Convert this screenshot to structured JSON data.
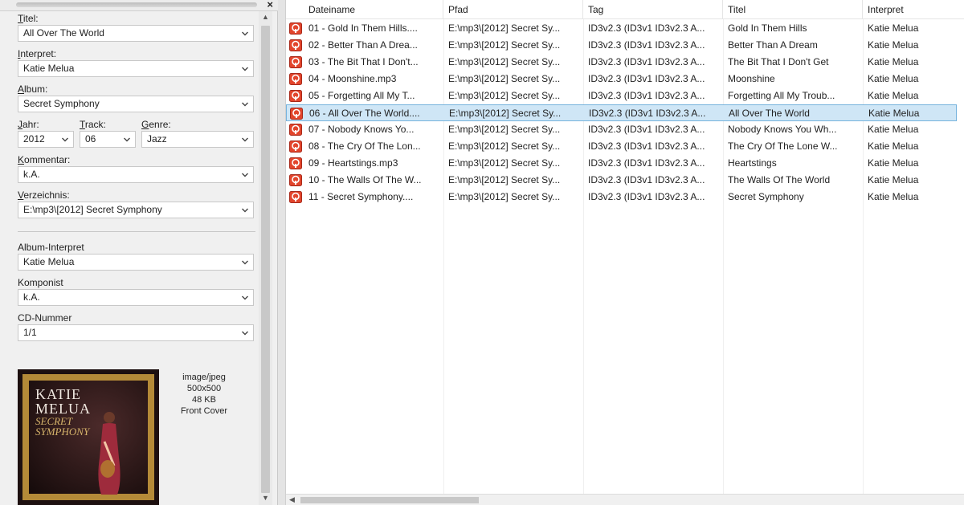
{
  "tag_panel": {
    "fields": {
      "titel": {
        "label_u": "T",
        "label_rest": "itel:",
        "value": "All Over The World"
      },
      "interpret": {
        "label_u": "I",
        "label_rest": "nterpret:",
        "value": "Katie Melua"
      },
      "album": {
        "label_u": "A",
        "label_rest": "lbum:",
        "value": "Secret Symphony"
      },
      "jahr": {
        "label_u": "J",
        "label_rest": "ahr:",
        "value": "2012"
      },
      "track": {
        "label_u": "T",
        "label_rest": "rack:",
        "value": "06"
      },
      "genre": {
        "label_u": "G",
        "label_rest": "enre:",
        "value": "Jazz"
      },
      "kommentar": {
        "label_u": "K",
        "label_rest": "ommentar:",
        "value": "k.A."
      },
      "verzeichnis": {
        "label_u": "V",
        "label_rest": "erzeichnis:",
        "value": "E:\\mp3\\[2012] Secret Symphony"
      },
      "album_interpret": {
        "label": "Album-Interpret",
        "value": "Katie Melua"
      },
      "komponist": {
        "label": "Komponist",
        "value": "k.A."
      },
      "cd_nummer": {
        "label": "CD-Nummer",
        "value": "1/1"
      }
    },
    "cover": {
      "art_title": "KATIE MELUA",
      "art_title_line1": "KATIE",
      "art_title_line2": "MELUA",
      "art_sub_line1": "SECRET",
      "art_sub_line2": "SYMPHONY",
      "mime": "image/jpeg",
      "dimensions": "500x500",
      "size": "48 KB",
      "type": "Front Cover"
    }
  },
  "file_list": {
    "columns": [
      "Dateiname",
      "Pfad",
      "Tag",
      "Titel",
      "Interpret"
    ],
    "rows": [
      {
        "dateiname": "01 - Gold In Them Hills....",
        "pfad": "E:\\mp3\\[2012] Secret Sy...",
        "tag": "ID3v2.3 (ID3v1 ID3v2.3 A...",
        "titel": "Gold In Them Hills",
        "interpret": "Katie Melua"
      },
      {
        "dateiname": "02 - Better Than A Drea...",
        "pfad": "E:\\mp3\\[2012] Secret Sy...",
        "tag": "ID3v2.3 (ID3v1 ID3v2.3 A...",
        "titel": "Better Than A Dream",
        "interpret": "Katie Melua"
      },
      {
        "dateiname": "03 - The Bit That I Don't...",
        "pfad": "E:\\mp3\\[2012] Secret Sy...",
        "tag": "ID3v2.3 (ID3v1 ID3v2.3 A...",
        "titel": "The Bit That I Don't Get",
        "interpret": "Katie Melua"
      },
      {
        "dateiname": "04 - Moonshine.mp3",
        "pfad": "E:\\mp3\\[2012] Secret Sy...",
        "tag": "ID3v2.3 (ID3v1 ID3v2.3 A...",
        "titel": "Moonshine",
        "interpret": "Katie Melua"
      },
      {
        "dateiname": "05 - Forgetting All My T...",
        "pfad": "E:\\mp3\\[2012] Secret Sy...",
        "tag": "ID3v2.3 (ID3v1 ID3v2.3 A...",
        "titel": "Forgetting All My Troub...",
        "interpret": "Katie Melua"
      },
      {
        "dateiname": "06 - All Over The World....",
        "pfad": "E:\\mp3\\[2012] Secret Sy...",
        "tag": "ID3v2.3 (ID3v1 ID3v2.3 A...",
        "titel": "All Over The World",
        "interpret": "Katie Melua"
      },
      {
        "dateiname": "07 - Nobody Knows Yo...",
        "pfad": "E:\\mp3\\[2012] Secret Sy...",
        "tag": "ID3v2.3 (ID3v1 ID3v2.3 A...",
        "titel": "Nobody Knows You Wh...",
        "interpret": "Katie Melua"
      },
      {
        "dateiname": "08 - The Cry Of The Lon...",
        "pfad": "E:\\mp3\\[2012] Secret Sy...",
        "tag": "ID3v2.3 (ID3v1 ID3v2.3 A...",
        "titel": "The Cry Of The Lone W...",
        "interpret": "Katie Melua"
      },
      {
        "dateiname": "09 - Heartstings.mp3",
        "pfad": "E:\\mp3\\[2012] Secret Sy...",
        "tag": "ID3v2.3 (ID3v1 ID3v2.3 A...",
        "titel": "Heartstings",
        "interpret": "Katie Melua"
      },
      {
        "dateiname": "10 - The Walls Of The W...",
        "pfad": "E:\\mp3\\[2012] Secret Sy...",
        "tag": "ID3v2.3 (ID3v1 ID3v2.3 A...",
        "titel": "The Walls Of The World",
        "interpret": "Katie Melua"
      },
      {
        "dateiname": "11 - Secret Symphony....",
        "pfad": "E:\\mp3\\[2012] Secret Sy...",
        "tag": "ID3v2.3 (ID3v1 ID3v2.3 A...",
        "titel": "Secret Symphony",
        "interpret": "Katie Melua"
      }
    ],
    "selected_index": 5
  },
  "icons": {
    "file": "mp3-file-icon",
    "dropdown": "chevron-down-icon",
    "close": "close-icon"
  },
  "colors": {
    "selection_bg": "#cfe6f6",
    "selection_border": "#76b3dd",
    "file_icon": "#e2452c"
  }
}
